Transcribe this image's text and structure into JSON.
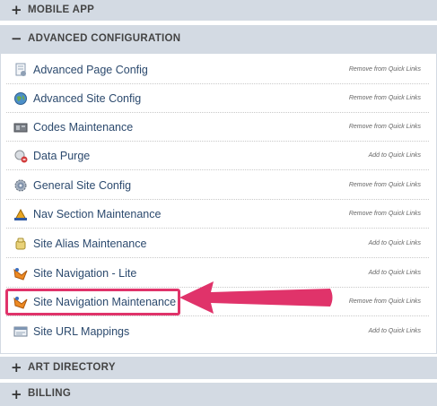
{
  "sections": {
    "mobile_app": {
      "sign": "+",
      "title": "MOBILE APP"
    },
    "advanced_configuration": {
      "sign": "−",
      "title": "ADVANCED CONFIGURATION"
    },
    "art_directory": {
      "sign": "+",
      "title": "ART DIRECTORY"
    },
    "billing": {
      "sign": "+",
      "title": "BILLING"
    }
  },
  "items": [
    {
      "label": "Advanced Page Config",
      "icon": "page-config-icon",
      "quick_link": "Remove from Quick Links"
    },
    {
      "label": "Advanced Site Config",
      "icon": "globe-icon",
      "quick_link": "Remove from Quick Links"
    },
    {
      "label": "Codes Maintenance",
      "icon": "codes-icon",
      "quick_link": "Remove from Quick Links"
    },
    {
      "label": "Data Purge",
      "icon": "data-purge-icon",
      "quick_link": "Add to Quick Links"
    },
    {
      "label": "General Site Config",
      "icon": "gear-icon",
      "quick_link": "Remove from Quick Links"
    },
    {
      "label": "Nav Section Maintenance",
      "icon": "nav-section-icon",
      "quick_link": "Remove from Quick Links"
    },
    {
      "label": "Site Alias Maintenance",
      "icon": "site-alias-icon",
      "quick_link": "Add to Quick Links"
    },
    {
      "label": "Site Navigation - Lite",
      "icon": "site-navigation-icon",
      "quick_link": "Add to Quick Links"
    },
    {
      "label": "Site Navigation Maintenance",
      "icon": "site-navigation-icon",
      "quick_link": "Remove from Quick Links"
    },
    {
      "label": "Site URL Mappings",
      "icon": "url-mappings-icon",
      "quick_link": "Add to Quick Links"
    }
  ],
  "colors": {
    "header_bg": "#d3dae3",
    "link": "#2c4a6e",
    "highlight": "#e0336a"
  }
}
